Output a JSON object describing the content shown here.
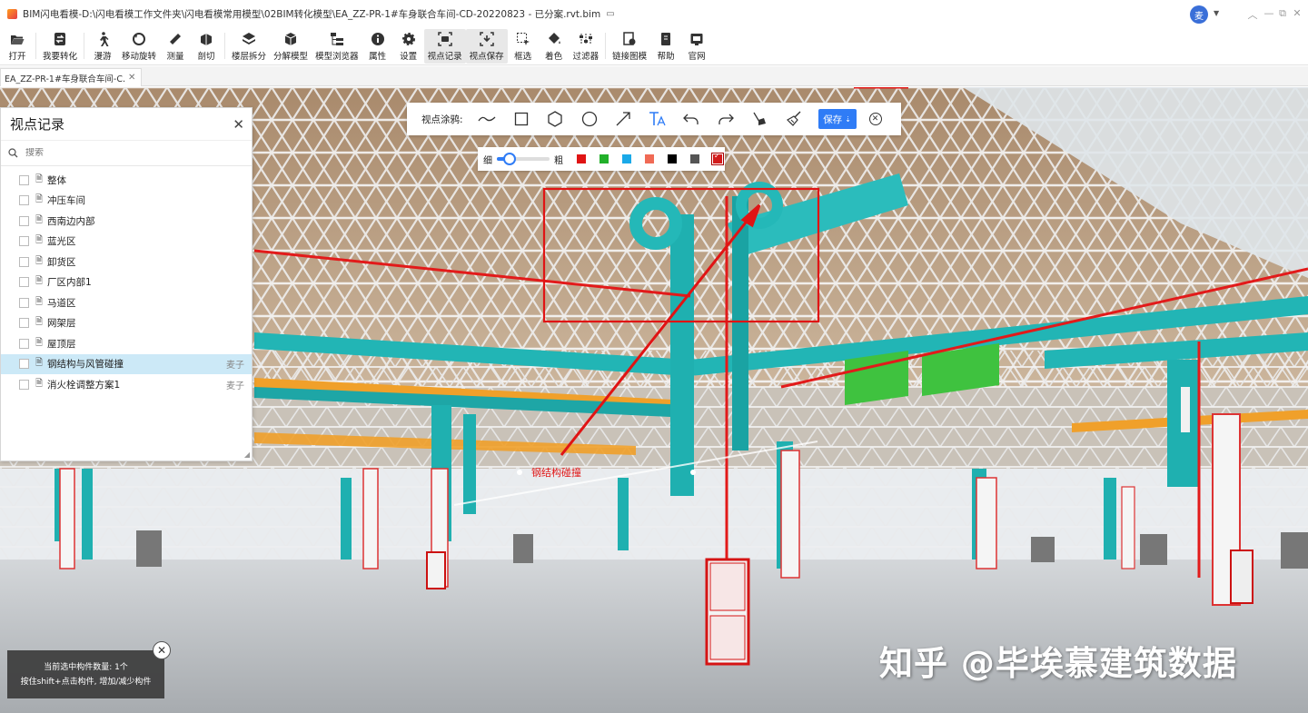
{
  "app": {
    "title": "BIM闪电看模-D:\\闪电看模工作文件夹\\闪电看模常用模型\\02BIM转化模型\\EA_ZZ-PR-1#车身联合车间-CD-20220823 - 已分案.rvt.bim",
    "user_initial": "麦"
  },
  "toolbar": {
    "items": [
      {
        "label": "打开",
        "icon": "folder-open-icon"
      },
      {
        "label": "我要转化",
        "icon": "convert-icon"
      },
      {
        "label": "漫游",
        "icon": "walk-icon"
      },
      {
        "label": "移动旋转",
        "icon": "rotate-icon"
      },
      {
        "label": "测量",
        "icon": "ruler-icon"
      },
      {
        "label": "剖切",
        "icon": "section-cut-icon"
      },
      {
        "label": "楼层拆分",
        "icon": "layers-icon"
      },
      {
        "label": "分解模型",
        "icon": "cube-icon"
      },
      {
        "label": "模型浏览器",
        "icon": "tree-icon"
      },
      {
        "label": "属性",
        "icon": "info-icon"
      },
      {
        "label": "设置",
        "icon": "gear-icon"
      },
      {
        "label": "视点记录",
        "icon": "viewpoint-icon"
      },
      {
        "label": "视点保存",
        "icon": "viewpoint-save-icon"
      },
      {
        "label": "框选",
        "icon": "box-select-icon"
      },
      {
        "label": "着色",
        "icon": "paint-bucket-icon"
      },
      {
        "label": "过滤器",
        "icon": "filter-icon"
      },
      {
        "label": "链接图模",
        "icon": "link-drawing-icon"
      },
      {
        "label": "帮助",
        "icon": "help-book-icon"
      },
      {
        "label": "官网",
        "icon": "website-icon"
      }
    ]
  },
  "tab": {
    "label": "EA_ZZ-PR-1#车身联合车间-C..."
  },
  "viewpoint_panel": {
    "title": "视点记录",
    "search_placeholder": "搜索",
    "items": [
      {
        "label": "整体",
        "owner": ""
      },
      {
        "label": "冲压车间",
        "owner": ""
      },
      {
        "label": "西南边内部",
        "owner": ""
      },
      {
        "label": "蓝光区",
        "owner": ""
      },
      {
        "label": "卸货区",
        "owner": ""
      },
      {
        "label": "厂区内部1",
        "owner": ""
      },
      {
        "label": "马道区",
        "owner": ""
      },
      {
        "label": "网架层",
        "owner": ""
      },
      {
        "label": "屋顶层",
        "owner": ""
      },
      {
        "label": "钢结构与风管碰撞",
        "owner": "麦子"
      },
      {
        "label": "消火栓调整方案1",
        "owner": "麦子"
      }
    ]
  },
  "annotation": {
    "label": "视点涂鸦:",
    "tools": [
      "freehand-icon",
      "rectangle-icon",
      "polygon-icon",
      "circle-icon",
      "arrow-icon",
      "text-icon",
      "undo-icon",
      "redo-icon",
      "eraser-icon",
      "clear-brush-icon"
    ],
    "save_label": "保存",
    "thin_label": "细",
    "thick_label": "粗",
    "stroke_level": 0.15,
    "colors": [
      "#e01414",
      "#22b02a",
      "#1aa9e8",
      "#f06a55",
      "#000000",
      "#555555",
      "#d21a1a"
    ],
    "selected_color_index": 6,
    "scene_text": "钢结构碰撞"
  },
  "selection_info": {
    "line1": "当前选中构件数量: 1个",
    "line2": "按住shift+点击构件, 增加/减少构件"
  },
  "watermark": "知乎 @毕埃慕建筑数据",
  "colors": {
    "accent": "#2f7cf6",
    "pipe": "#20b2b2",
    "annotation": "#e01414"
  }
}
